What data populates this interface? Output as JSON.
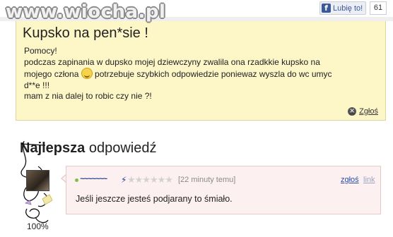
{
  "site": {
    "watermark": "www.wiocha.pl"
  },
  "facebook": {
    "like_label": "Lubię to!",
    "like_count": "61"
  },
  "question": {
    "title": "Kupsko na pen*sie !",
    "line1": "Pomocy!",
    "line2": "podczas zapinania w dupsko mojej dziewczyny zwalila ona rzadkkie kupsko na",
    "line3a": "mojego człona ",
    "line3b": " potrzebuje szybkich odpowiedzie poniewaz wyszla do wc umyc",
    "line4": "d**e !!!",
    "line5": "mam z nia dalej to robic czy nie ?!",
    "report_label": "Zgłoś"
  },
  "best_answer": {
    "heading_bold": "Najlepsza",
    "heading_rest": " odpowiedź",
    "time": "[22 minuty temu]",
    "report_label": "zgłoś",
    "link_label": "link",
    "text": "Jeśli jeszcze jesteś podjarany to śmiało.",
    "stars": "★★★★★★",
    "rating_percent": "100%"
  },
  "colors": {
    "question_bg": "#fdf6c7",
    "answer_bg": "#fdf0f0",
    "link_blue": "#2a4ca8"
  }
}
